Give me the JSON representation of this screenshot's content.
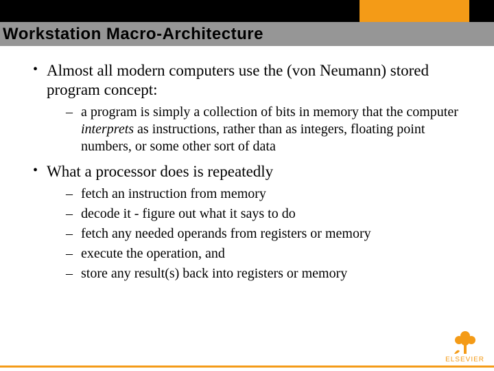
{
  "title": "Workstation Macro-Architecture",
  "bullets": [
    {
      "text": "Almost all modern computers use the (von Neumann) stored program concept:",
      "sub": [
        {
          "pre": "a program is simply a collection of bits in memory that the computer ",
          "em": "interprets",
          "post": " as instructions, rather than as integers, floating point numbers, or some other sort of data"
        }
      ]
    },
    {
      "text": "What a processor does is repeatedly",
      "sub": [
        {
          "pre": "fetch an instruction from memory"
        },
        {
          "pre": "decode it - figure out what it says to do"
        },
        {
          "pre": "fetch any needed operands from registers or memory"
        },
        {
          "pre": "execute the operation, and"
        },
        {
          "pre": "store any result(s) back into registers or memory"
        }
      ]
    }
  ],
  "brand": "ELSEVIER"
}
